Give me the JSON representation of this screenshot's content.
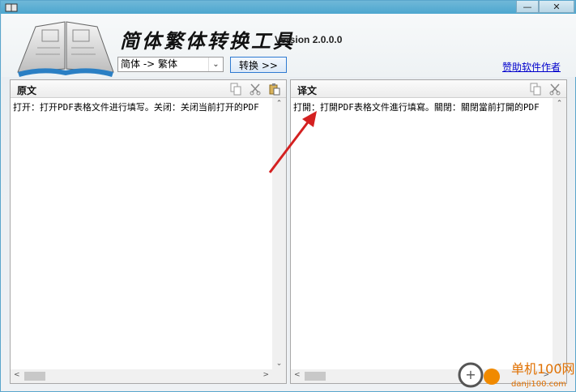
{
  "window": {
    "minimize_glyph": "—",
    "close_glyph": "✕"
  },
  "header": {
    "app_title": "简体繁体转换工具",
    "version": "Version 2.0.0.0",
    "direction_select": "简体 -> 繁体",
    "convert_button": "转换 >>",
    "sponsor_link": "赞助软件作者"
  },
  "source_panel": {
    "title": "原文",
    "text": "打开：打开PDF表格文件进行填写。关闭：关闭当前打开的PDF"
  },
  "target_panel": {
    "title": "译文",
    "text": "打開：打開PDF表格文件進行填寫。關閉：關閉當前打開的PDF"
  },
  "watermark": {
    "name": "单机100网",
    "url": "danji100.com"
  },
  "colors": {
    "title_bar": "#4da6cf",
    "link": "#0000cc",
    "arrow": "#d42020"
  }
}
